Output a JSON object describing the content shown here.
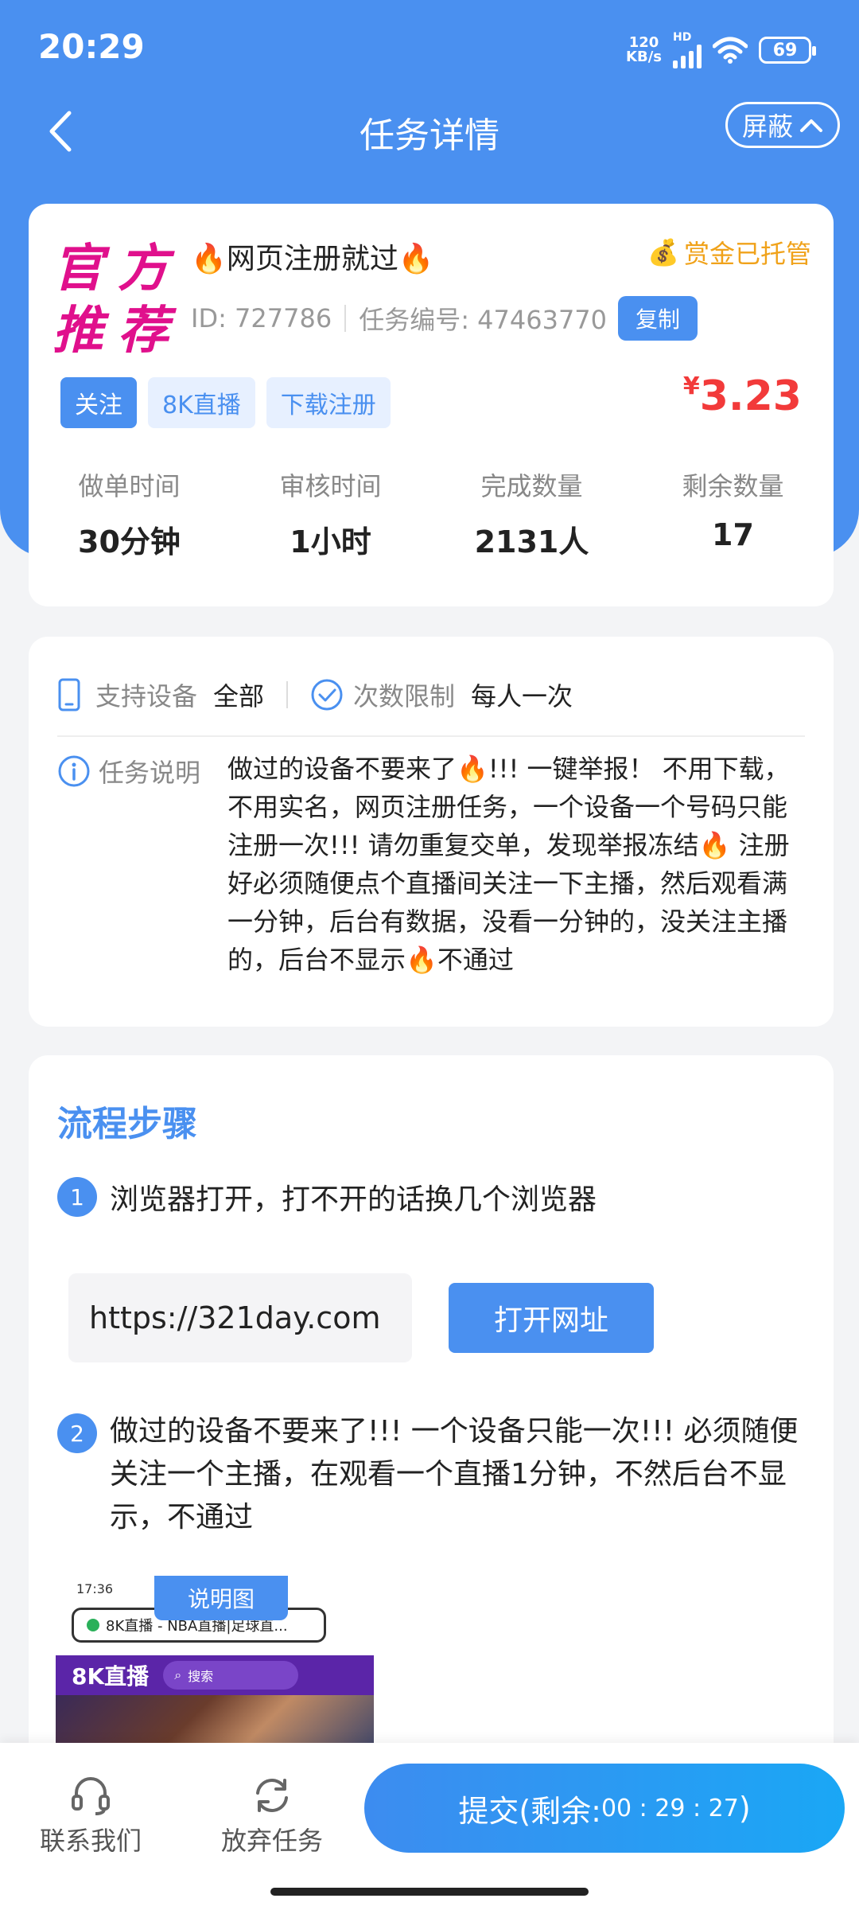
{
  "status": {
    "time": "20:29",
    "net_speed_value": "120",
    "net_speed_unit": "KB/s",
    "network_badge": "HD",
    "battery": "69"
  },
  "nav": {
    "title": "任务详情",
    "shield_label": "屏蔽"
  },
  "task": {
    "seal_text": [
      "官",
      "方",
      "推",
      "荐"
    ],
    "title": "🔥网页注册就过🔥",
    "bounty_label": "赏金已托管",
    "id_label": "ID: 727786",
    "task_no_label": "任务编号: 47463770",
    "copy_label": "复制",
    "tags": [
      "关注",
      "8K直播",
      "下载注册"
    ],
    "price_symbol": "¥",
    "price": "3.23",
    "stats": [
      {
        "label": "做单时间",
        "value": "30分钟"
      },
      {
        "label": "审核时间",
        "value": "1小时"
      },
      {
        "label": "完成数量",
        "value": "2131人"
      },
      {
        "label": "剩余数量",
        "value": "17"
      }
    ]
  },
  "info": {
    "device_label": "支持设备",
    "device_value": "全部",
    "limit_label": "次数限制",
    "limit_value": "每人一次",
    "desc_label": "任务说明",
    "desc_text": "做过的设备不要来了🔥!!! 一键举报！ 不用下载，不用实名，网页注册任务，一个设备一个号码只能注册一次!!! 请勿重复交单，发现举报冻结🔥 注册好必须随便点个直播间关注一下主播，然后观看满一分钟，后台有数据，没看一分钟的，没关注主播的，后台不显示🔥不通过"
  },
  "steps": {
    "title": "流程步骤",
    "items": [
      {
        "num": "1",
        "text": "浏览器打开，打不开的话换几个浏览器"
      },
      {
        "num": "2",
        "text": "做过的设备不要来了!!! 一个设备只能一次!!! 必须随便关注一个主播，在观看一个直播1分钟，不然后台不显示，不通过"
      }
    ],
    "url": "https://321day.com",
    "open_label": "打开网址",
    "explain_tag": "说明图",
    "sample": {
      "time": "17:36",
      "url_text": "8K直播 - NBA直播|足球直...",
      "brand": "8K直播",
      "search": "搜索"
    }
  },
  "bottom": {
    "contact_label": "联系我们",
    "abandon_label": "放弃任务",
    "submit_label": "提交(剩余:",
    "countdown": "00 : 29 : 27",
    "submit_suffix": ")"
  },
  "colors": {
    "primary": "#4a90f0",
    "price": "#f23a3a",
    "bounty": "#f0a21a",
    "seal": "#e0108c"
  }
}
